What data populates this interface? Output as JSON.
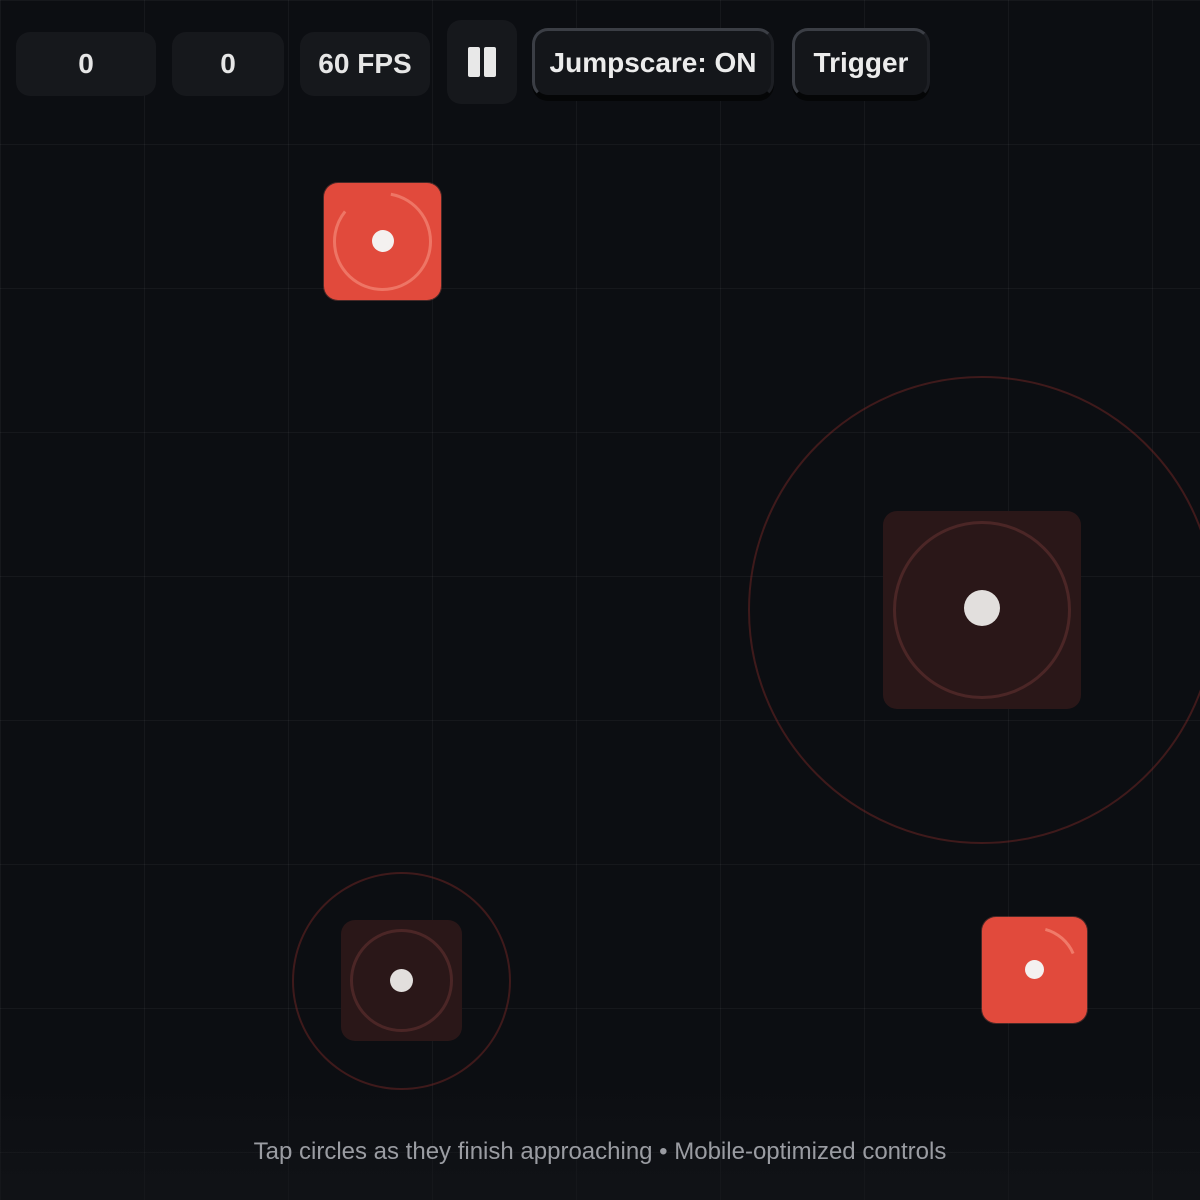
{
  "hud": {
    "score": "0",
    "combo": "0",
    "fps": "60 FPS",
    "jumpscare_label": "Jumpscare: ON",
    "trigger_label": "Trigger"
  },
  "icons": {
    "pause": "pause-icon"
  },
  "colors": {
    "background": "#0c0e12",
    "note_active": "#e14a3c",
    "note_pending": "#2a1718",
    "approach_ring": "#a0322d",
    "hud_panel": "#16181c"
  },
  "footer": {
    "hint": "Tap circles as they finish approaching • Mobile-optimized controls"
  }
}
